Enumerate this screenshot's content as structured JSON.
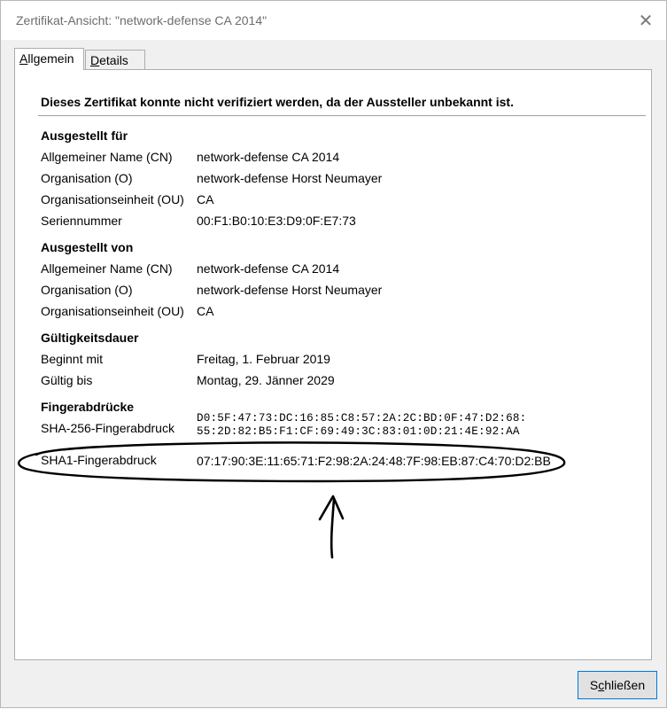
{
  "window": {
    "title": "Zertifikat-Ansicht: \"network-defense CA 2014\"",
    "close_glyph": "✕"
  },
  "tabs": [
    {
      "label": "Allgemein",
      "accesskey": "A",
      "rest": "llgemein",
      "active": true
    },
    {
      "label": "Details",
      "accesskey": "D",
      "rest": "etails",
      "active": false
    }
  ],
  "general": {
    "warning": "Dieses Zertifikat konnte nicht verifiziert werden, da der Aussteller unbekannt ist.",
    "issued_to": {
      "heading": "Ausgestellt für",
      "rows": [
        {
          "label": "Allgemeiner Name (CN)",
          "value": "network-defense CA 2014"
        },
        {
          "label": "Organisation (O)",
          "value": "network-defense Horst Neumayer"
        },
        {
          "label": "Organisationseinheit (OU)",
          "value": "CA"
        },
        {
          "label": "Seriennummer",
          "value": "00:F1:B0:10:E3:D9:0F:E7:73"
        }
      ]
    },
    "issued_by": {
      "heading": "Ausgestellt von",
      "rows": [
        {
          "label": "Allgemeiner Name (CN)",
          "value": "network-defense CA 2014"
        },
        {
          "label": "Organisation (O)",
          "value": "network-defense Horst Neumayer"
        },
        {
          "label": "Organisationseinheit (OU)",
          "value": "CA"
        }
      ]
    },
    "validity": {
      "heading": "Gültigkeitsdauer",
      "rows": [
        {
          "label": "Beginnt mit",
          "value": "Freitag, 1. Februar 2019"
        },
        {
          "label": "Gültig bis",
          "value": "Montag, 29. Jänner 2029"
        }
      ]
    },
    "fingerprints": {
      "heading": "Fingerabdrücke",
      "sha256": {
        "label": "SHA-256-Fingerabdruck",
        "line1": "D0:5F:47:73:DC:16:85:C8:57:2A:2C:BD:0F:47:D2:68:",
        "line2": "55:2D:82:B5:F1:CF:69:49:3C:83:01:0D:21:4E:92:AA"
      },
      "sha1": {
        "label": "SHA1-Fingerabdruck",
        "value": "07:17:90:3E:11:65:71:F2:98:2A:24:48:7F:98:EB:87:C4:70:D2:BB"
      }
    }
  },
  "footer": {
    "close_button": {
      "label": "Schließen",
      "accesskey": "c",
      "pre": "S",
      "rest": "hließen"
    }
  }
}
